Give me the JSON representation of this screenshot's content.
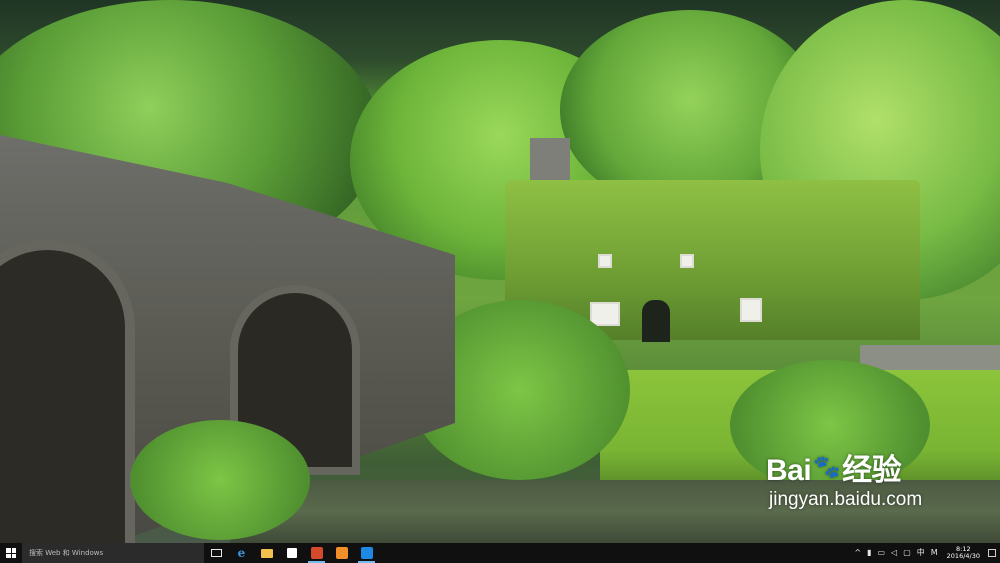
{
  "wallpaper": {
    "description_colors": [
      "#5f9a3a",
      "#6e6e6a",
      "#4d5a43"
    ]
  },
  "watermark": {
    "brand_prefix": "Bai",
    "brand_suffix": "经验",
    "paw_icon": "paw-icon",
    "url": "jingyan.baidu.com"
  },
  "taskbar": {
    "start_icon": "windows-logo-icon",
    "search_placeholder": "搜索 Web 和 Windows",
    "pinned": [
      {
        "name": "task-view",
        "icon": "task-view-icon"
      },
      {
        "name": "edge",
        "icon": "edge-icon",
        "glyph": "e"
      },
      {
        "name": "file-explorer",
        "icon": "folder-icon"
      },
      {
        "name": "store",
        "icon": "store-icon"
      },
      {
        "name": "app-1",
        "icon": "app-icon",
        "color": "#d44a2a"
      },
      {
        "name": "app-2",
        "icon": "app-icon",
        "color": "#f0902a"
      },
      {
        "name": "app-3",
        "icon": "gear-app-icon",
        "color": "#1e88e5"
      }
    ],
    "tray": {
      "chevron": "^",
      "icons": [
        "battery-icon",
        "network-icon",
        "volume-icon",
        "message-icon"
      ],
      "ime_label": "中",
      "ime_mode": "M",
      "time": "8:12",
      "date": "2016/4/30"
    }
  }
}
